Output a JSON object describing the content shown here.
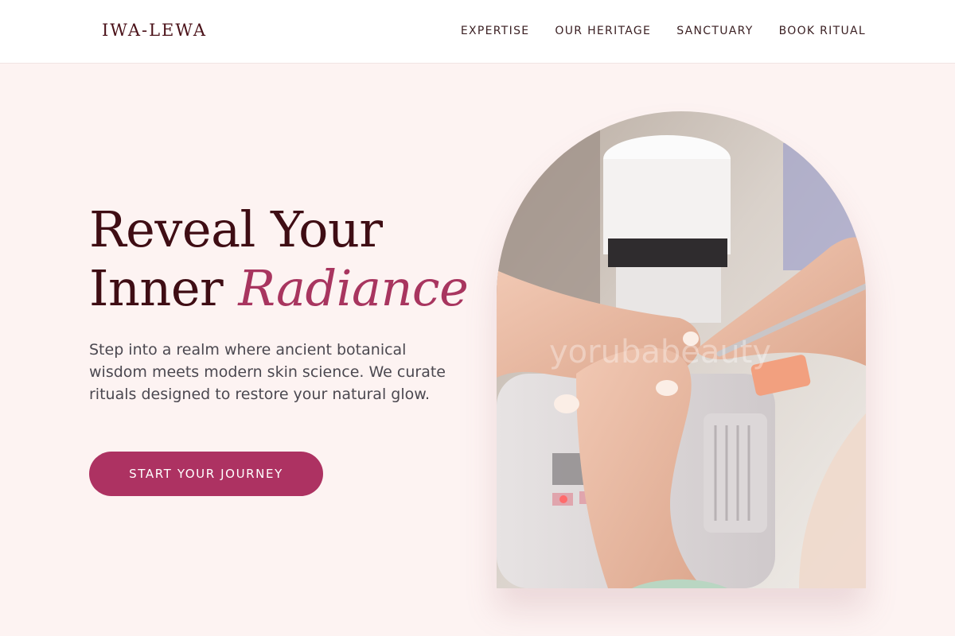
{
  "header": {
    "logo": "IWA-LEWA",
    "nav": [
      "EXPERTISE",
      "OUR HERITAGE",
      "SANCTUARY",
      "BOOK RITUAL"
    ]
  },
  "hero": {
    "title_line1": "Reveal Your",
    "title_line2_plain": "Inner ",
    "title_line2_accent": "Radiance",
    "body": "Step into a realm where ancient botanical wisdom meets modern skin science. We curate rituals designed to restore your natural glow.",
    "cta_label": "START YOUR JOURNEY",
    "image_watermark": "yorubabeauty",
    "image_subject": "nail-care-photo"
  },
  "colors": {
    "brand_dark": "#3f0d14",
    "accent": "#a8355f",
    "button": "#ad3262",
    "page_bg": "#fdf3f2"
  }
}
